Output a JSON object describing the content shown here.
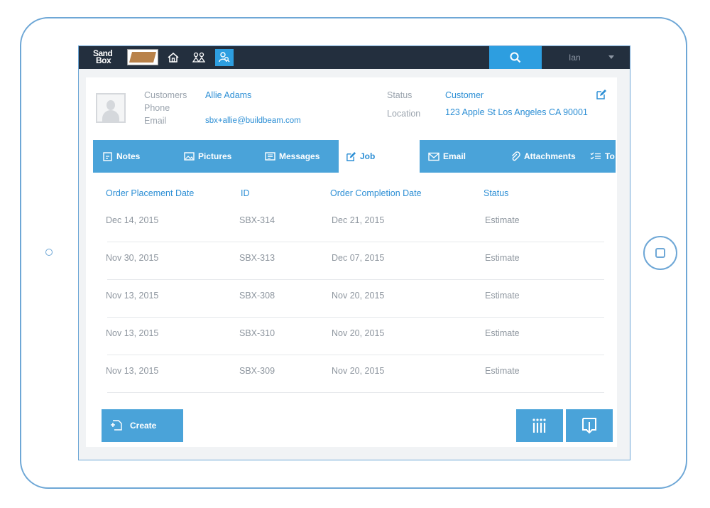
{
  "topbar": {
    "logo_line1": "Sand",
    "logo_line2": "Box",
    "user_name": "Ian",
    "icons": [
      "home-icon",
      "people-icon",
      "user-search-icon",
      "search-icon",
      "chevron-down-icon"
    ]
  },
  "customer": {
    "labels": {
      "customers": "Customers",
      "phone": "Phone",
      "email": "Email",
      "status": "Status",
      "location": "Location"
    },
    "name": "Allie Adams",
    "email": "sbx+allie@buildbeam.com",
    "status": "Customer",
    "location": "123 Apple St  Los Angeles CA 90001"
  },
  "tabs": [
    {
      "label": "Notes",
      "icon": "notes-icon"
    },
    {
      "label": "Pictures",
      "icon": "picture-icon"
    },
    {
      "label": "Messages",
      "icon": "messages-icon"
    },
    {
      "label": "Job",
      "icon": "edit-icon",
      "active": true
    },
    {
      "label": "Email",
      "icon": "email-icon"
    },
    {
      "label": "Attachments",
      "icon": "paperclip-icon"
    },
    {
      "label": "To",
      "icon": "checklist-icon"
    }
  ],
  "table": {
    "headers": [
      "Order Placement Date",
      "ID",
      "Order Completion Date",
      "Status"
    ],
    "rows": [
      [
        "Dec 14, 2015",
        "SBX-314",
        "Dec 21, 2015",
        "Estimate"
      ],
      [
        "Nov 30, 2015",
        "SBX-313",
        "Dec 07, 2015",
        "Estimate"
      ],
      [
        "Nov 13, 2015",
        "SBX-308",
        "Nov 20, 2015",
        "Estimate"
      ],
      [
        "Nov 13, 2015",
        "SBX-310",
        "Nov 20, 2015",
        "Estimate"
      ],
      [
        "Nov 13, 2015",
        "SBX-309",
        "Nov 20, 2015",
        "Estimate"
      ]
    ]
  },
  "actions": {
    "create_label": "Create"
  },
  "colors": {
    "topbar": "#232f3e",
    "accent": "#2d9ee0",
    "tab_bar": "#4aa3d9",
    "link": "#2d8fd5",
    "frame": "#6ea7d6"
  }
}
